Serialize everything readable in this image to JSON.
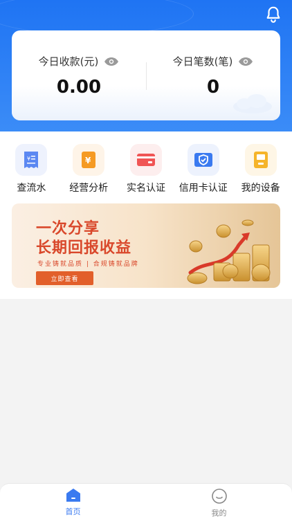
{
  "header": {
    "notification_icon": "bell-icon"
  },
  "stats": {
    "income_label": "今日收款(元)",
    "income_value": "0.00",
    "count_label": "今日笔数(笔)",
    "count_value": "0",
    "eye_icon": "eye-icon"
  },
  "menu": {
    "items": [
      {
        "label": "查流水",
        "icon": "receipt-icon",
        "color": "#4c7cf0"
      },
      {
        "label": "经营分析",
        "icon": "yuan-icon",
        "color": "#f59a23"
      },
      {
        "label": "实名认证",
        "icon": "card-icon",
        "color": "#f05454"
      },
      {
        "label": "信用卡认证",
        "icon": "shield-icon",
        "color": "#3a7af0"
      },
      {
        "label": "我的设备",
        "icon": "pos-device-icon",
        "color": "#f5b42a"
      }
    ]
  },
  "banner": {
    "title_line1": "一次分享",
    "title_line2": "长期回报收益",
    "slogan": "专业铸就品质 | 合规铸就品牌",
    "cta_label": "立即查看"
  },
  "tabbar": {
    "tabs": [
      {
        "label": "首页",
        "icon": "home-icon",
        "active": true
      },
      {
        "label": "我的",
        "icon": "smiley-icon",
        "active": false
      }
    ],
    "active_color": "#3a7af0",
    "inactive_color": "#888888"
  }
}
